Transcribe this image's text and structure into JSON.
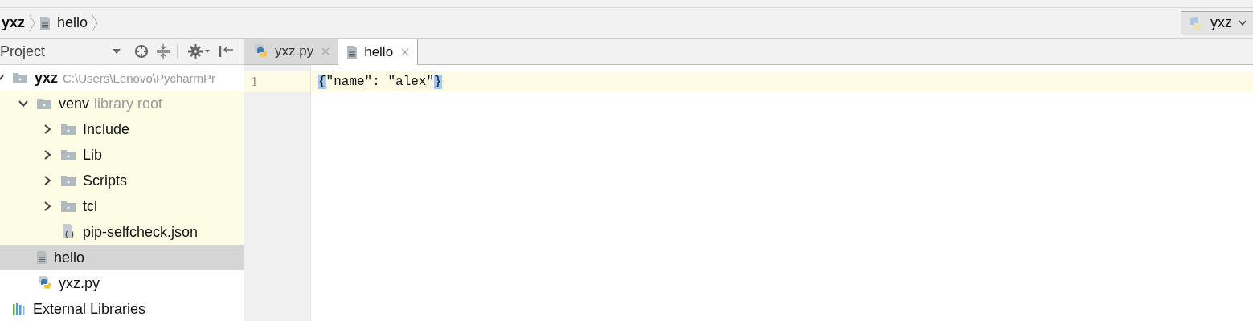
{
  "breadcrumbs": [
    {
      "label": "yxz",
      "kind": "project"
    },
    {
      "label": "hello",
      "kind": "file"
    }
  ],
  "run_config": {
    "label": "yxz"
  },
  "project_panel": {
    "title": "Project"
  },
  "tree": [
    {
      "label": "yxz",
      "kind": "folder",
      "path": "C:\\Users\\Lenovo\\PycharmPr",
      "expanded": true,
      "selected": false,
      "children": [
        {
          "label": "venv",
          "kind": "folder",
          "note": "library root",
          "library_root": true,
          "expanded": true,
          "selected": false,
          "children": [
            {
              "label": "Include",
              "kind": "folder",
              "expanded": false,
              "selected": false
            },
            {
              "label": "Lib",
              "kind": "folder",
              "expanded": false,
              "selected": false
            },
            {
              "label": "Scripts",
              "kind": "folder",
              "expanded": false,
              "selected": false
            },
            {
              "label": "tcl",
              "kind": "folder",
              "expanded": false,
              "selected": false
            },
            {
              "label": "pip-selfcheck.json",
              "kind": "json",
              "selected": false
            }
          ]
        },
        {
          "label": "hello",
          "kind": "text",
          "selected": true
        },
        {
          "label": "yxz.py",
          "kind": "python",
          "selected": false
        }
      ]
    },
    {
      "label": "External Libraries",
      "kind": "libraries",
      "selected": false
    }
  ],
  "tabs": [
    {
      "label": "yxz.py",
      "kind": "python",
      "selected": false
    },
    {
      "label": "hello",
      "kind": "text",
      "selected": true
    }
  ],
  "editor": {
    "lines": [
      {
        "number": "1",
        "text": "{\"name\": \"alex\"}",
        "current": true,
        "matched_braces": true
      }
    ]
  }
}
